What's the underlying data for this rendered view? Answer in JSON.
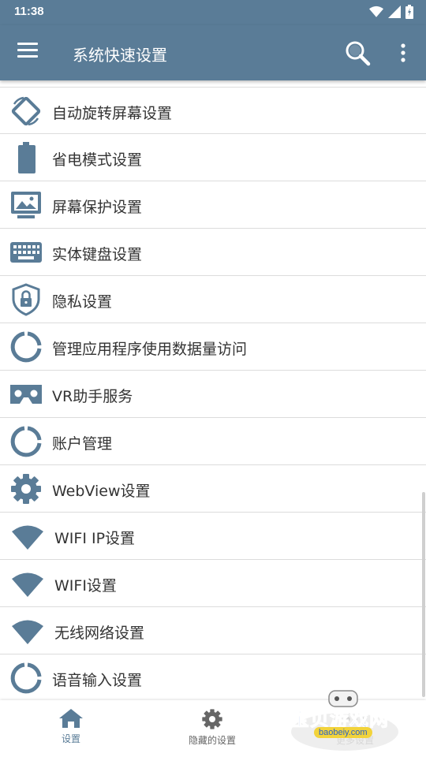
{
  "status_bar": {
    "time": "11:38"
  },
  "app_bar": {
    "title": "系统快速设置"
  },
  "colors": {
    "primary": "#5a7c97",
    "divider": "#dcdcdc",
    "text": "#333333"
  },
  "list": {
    "items": [
      {
        "label": "自动旋转屏幕设置",
        "icon": "rotate-screen-icon"
      },
      {
        "label": "省电模式设置",
        "icon": "battery-icon"
      },
      {
        "label": "屏幕保护设置",
        "icon": "screensaver-icon"
      },
      {
        "label": "实体键盘设置",
        "icon": "keyboard-icon"
      },
      {
        "label": "隐私设置",
        "icon": "privacy-shield-icon"
      },
      {
        "label": "管理应用程序使用数据量访问",
        "icon": "data-usage-icon"
      },
      {
        "label": "VR助手服务",
        "icon": "vr-headset-icon"
      },
      {
        "label": "账户管理",
        "icon": "account-icon"
      },
      {
        "label": "WebView设置",
        "icon": "gear-icon"
      },
      {
        "label": "WIFI IP设置",
        "icon": "wifi-icon"
      },
      {
        "label": "WIFI设置",
        "icon": "wifi-icon"
      },
      {
        "label": "无线网络设置",
        "icon": "wifi-icon"
      },
      {
        "label": "语音输入设置",
        "icon": "voice-input-icon"
      }
    ]
  },
  "bottom_nav": {
    "items": [
      {
        "label": "设置",
        "icon": "home-icon",
        "active": true
      },
      {
        "label": "隐藏的设置",
        "icon": "gear-icon",
        "active": false
      },
      {
        "label": "更多设置",
        "icon": "more-icon",
        "active": false
      }
    ]
  },
  "watermark": {
    "text": "宝贝游戏网",
    "url": "baobeiy.com"
  }
}
